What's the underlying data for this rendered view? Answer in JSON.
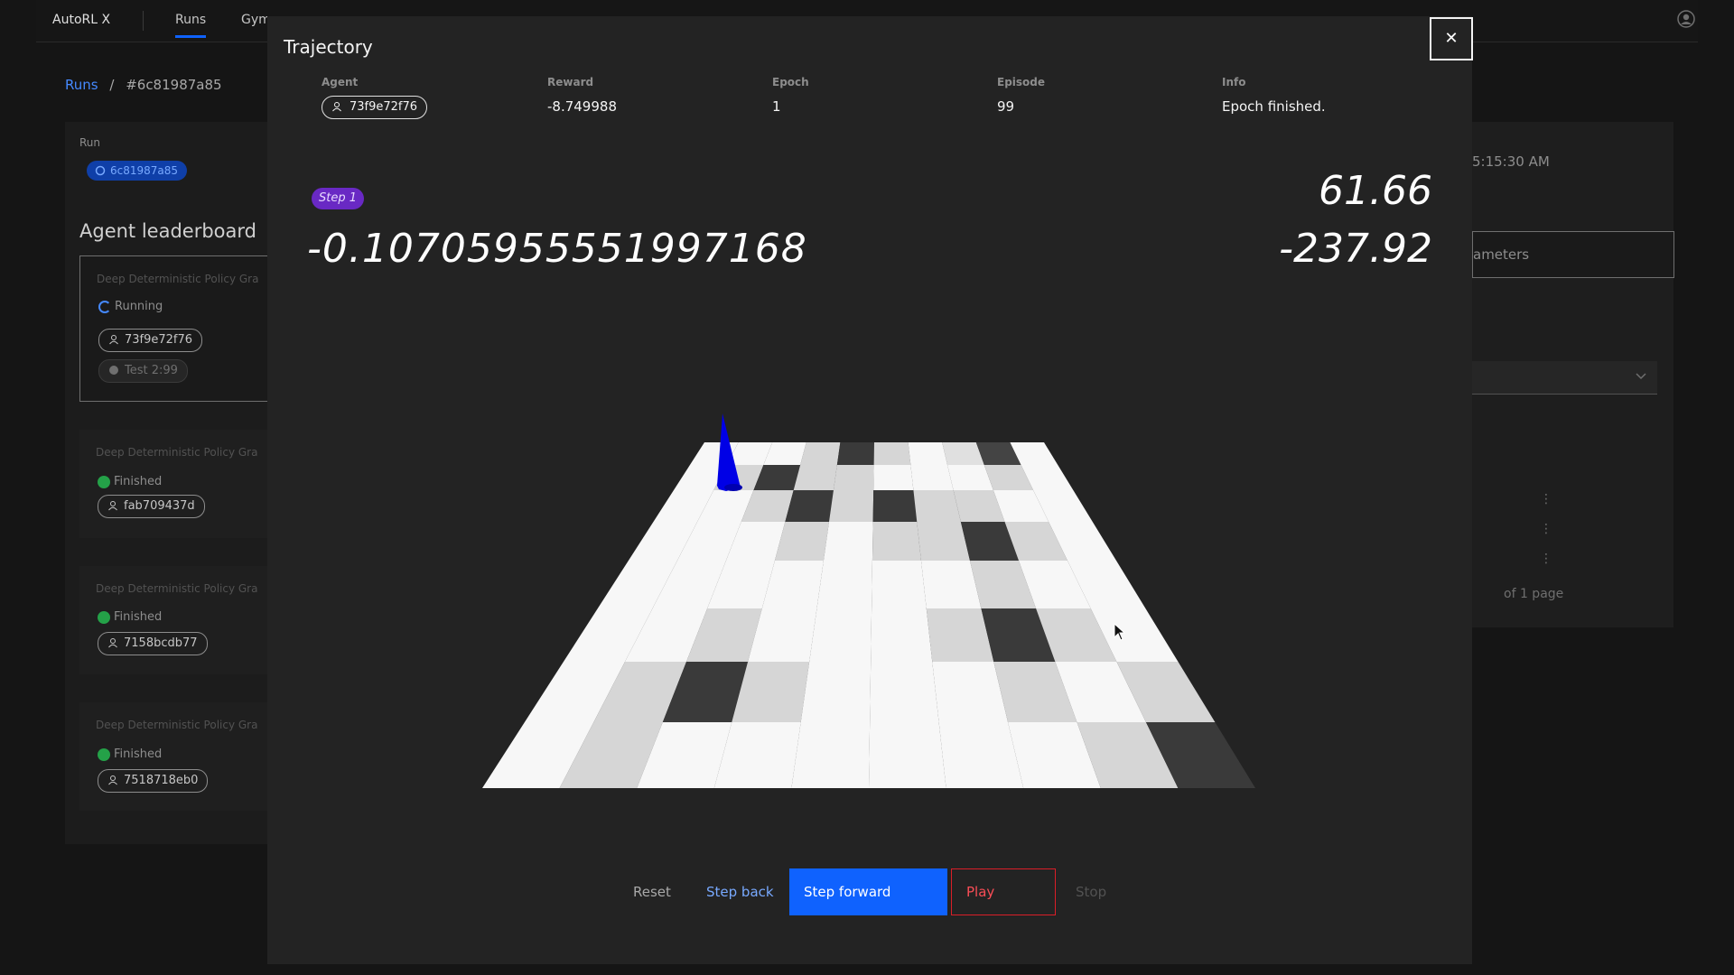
{
  "app": {
    "brand": "AutoRL X",
    "nav": [
      "Runs",
      "Gym"
    ],
    "breadcrumb": {
      "root": "Runs",
      "sep": "/",
      "current": "#6c81987a85"
    },
    "run_label": "Run",
    "run_tag": "6c81987a85",
    "leaderboard_title": "Agent leaderboard",
    "cards": [
      {
        "algo": "Deep Deterministic Policy Gra",
        "status": "Running",
        "agent": "73f9e72f76",
        "extra": "Test 2:99"
      },
      {
        "algo": "Deep Deterministic Policy Gra",
        "status": "Finished",
        "agent": "fab709437d"
      },
      {
        "algo": "Deep Deterministic Policy Gra",
        "status": "Finished",
        "agent": "7158bcdb77"
      },
      {
        "algo": "Deep Deterministic Policy Gra",
        "status": "Finished",
        "agent": "7518718eb0"
      }
    ],
    "right": {
      "time": "5:15:30 AM",
      "button": "ameters",
      "pager": "of 1 page"
    }
  },
  "modal": {
    "title": "Trajectory",
    "close": "✕",
    "meta": {
      "agent_label": "Agent",
      "agent": "73f9e72f76",
      "reward_label": "Reward",
      "reward": "-8.749988",
      "epoch_label": "Epoch",
      "epoch": "1",
      "episode_label": "Episode",
      "episode": "99",
      "info_label": "Info",
      "info": "Epoch finished."
    },
    "step_tag": "Step 1",
    "readout_left": "-0.10705955551997168",
    "readout_right_top": "61.66",
    "readout_right_bottom": "-237.92",
    "controls": {
      "reset": "Reset",
      "step_back": "Step back",
      "step_forward": "Step forward",
      "play": "Play",
      "stop": "Stop"
    },
    "colors": {
      "primary": "#0f62fe",
      "danger": "#da1e28",
      "step_tag": "#6929c4",
      "agent_marker": "#0000e6"
    }
  }
}
